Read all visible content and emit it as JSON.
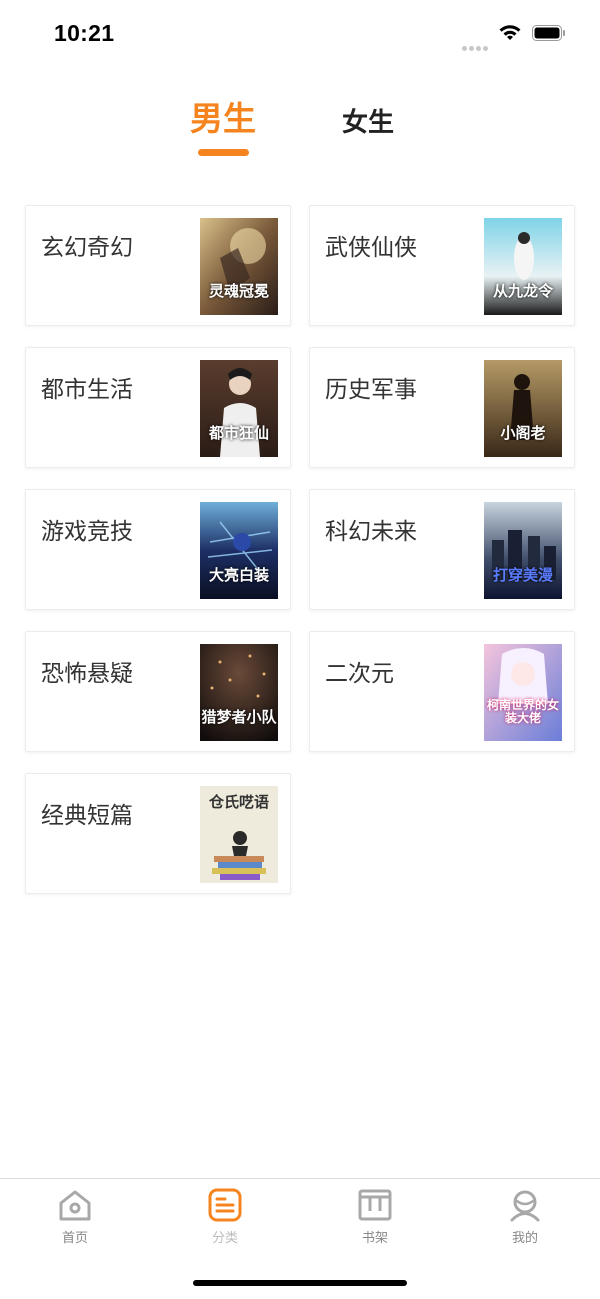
{
  "status_bar": {
    "time": "10:21"
  },
  "gender_tabs": [
    {
      "label": "男生",
      "active": true
    },
    {
      "label": "女生",
      "active": false
    }
  ],
  "categories": [
    {
      "label": "玄幻奇幻",
      "cover_title": "灵魂冠冕"
    },
    {
      "label": "武侠仙侠",
      "cover_title": "从九龙令"
    },
    {
      "label": "都市生活",
      "cover_title": "都市狂仙"
    },
    {
      "label": "历史军事",
      "cover_title": "小阁老"
    },
    {
      "label": "游戏竞技",
      "cover_title": "大亮白装"
    },
    {
      "label": "科幻未来",
      "cover_title": "打穿美漫"
    },
    {
      "label": "恐怖悬疑",
      "cover_title": "猎梦者小队"
    },
    {
      "label": "二次元",
      "cover_title": "柯南世界的女装大佬"
    },
    {
      "label": "经典短篇",
      "cover_title": "仓氏呓语"
    }
  ],
  "tabbar": {
    "items": [
      {
        "label": "首页",
        "icon": "home-icon"
      },
      {
        "label": "分类",
        "icon": "category-icon",
        "active": true
      },
      {
        "label": "书架",
        "icon": "bookshelf-icon"
      },
      {
        "label": "我的",
        "icon": "profile-icon"
      }
    ]
  },
  "colors": {
    "accent": "#f5841f",
    "text": "#333333",
    "tab_inactive": "#888888"
  }
}
